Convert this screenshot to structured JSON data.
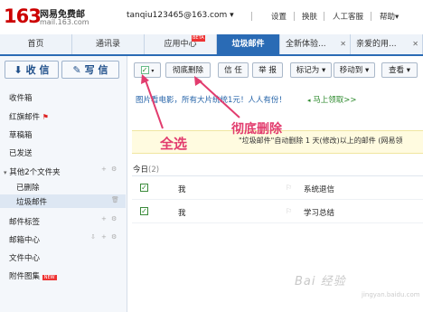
{
  "header": {
    "logo_number": "163",
    "logo_name": "网易免费邮",
    "logo_url": "mail.163.com",
    "user_email": "tanqiu123465@163.com ▾",
    "links": [
      "设置",
      "换肤",
      "人工客服",
      "帮助▾"
    ]
  },
  "tabs": [
    {
      "label": "首页"
    },
    {
      "label": "通讯录"
    },
    {
      "label": "应用中心",
      "badge": "BETA"
    },
    {
      "label": "垃圾邮件"
    },
    {
      "label": "全新体验..."
    },
    {
      "label": "亲爱的用..."
    }
  ],
  "sidebar": {
    "receive_label": "收 信",
    "compose_label": "写 信",
    "items": {
      "inbox": "收件箱",
      "flagged": "红旗邮件",
      "drafts": "草稿箱",
      "sent": "已发送",
      "other_folders": "其他2个文件夹",
      "deleted": "已删除",
      "junk": "垃圾邮件",
      "labels": "邮件标签",
      "mail_center": "邮箱中心",
      "file_center": "文件中心",
      "attachments": "附件图集",
      "new_badge": "NEW"
    }
  },
  "toolbar": {
    "delete_forever": "彻底删除",
    "trust": "信 任",
    "report": "举 报",
    "mark_as": "标记为 ▾",
    "move_to": "移动到 ▾",
    "view": "查看 ▾"
  },
  "ad": {
    "text": "图片看电影，所有大片统统1元！人人有份！",
    "link": "马上领取>>"
  },
  "notice": {
    "text": "\"垃圾邮件\"自动删除 1 天(修改)以上的邮件 (网易领"
  },
  "list": {
    "group_label": "今日",
    "group_count": "(2)",
    "rows": [
      {
        "sender": "我",
        "subject": "系统退信"
      },
      {
        "sender": "我",
        "subject": "学习总结"
      }
    ]
  },
  "annotations": {
    "select_all": "全选",
    "delete_forever": "彻底删除"
  },
  "watermark": "Bai 经验",
  "watermark_url": "jingyan.baidu.com",
  "colors": {
    "accent": "#2a6bb5",
    "annotation": "#e23c6e",
    "brand_red": "#cc0000"
  }
}
